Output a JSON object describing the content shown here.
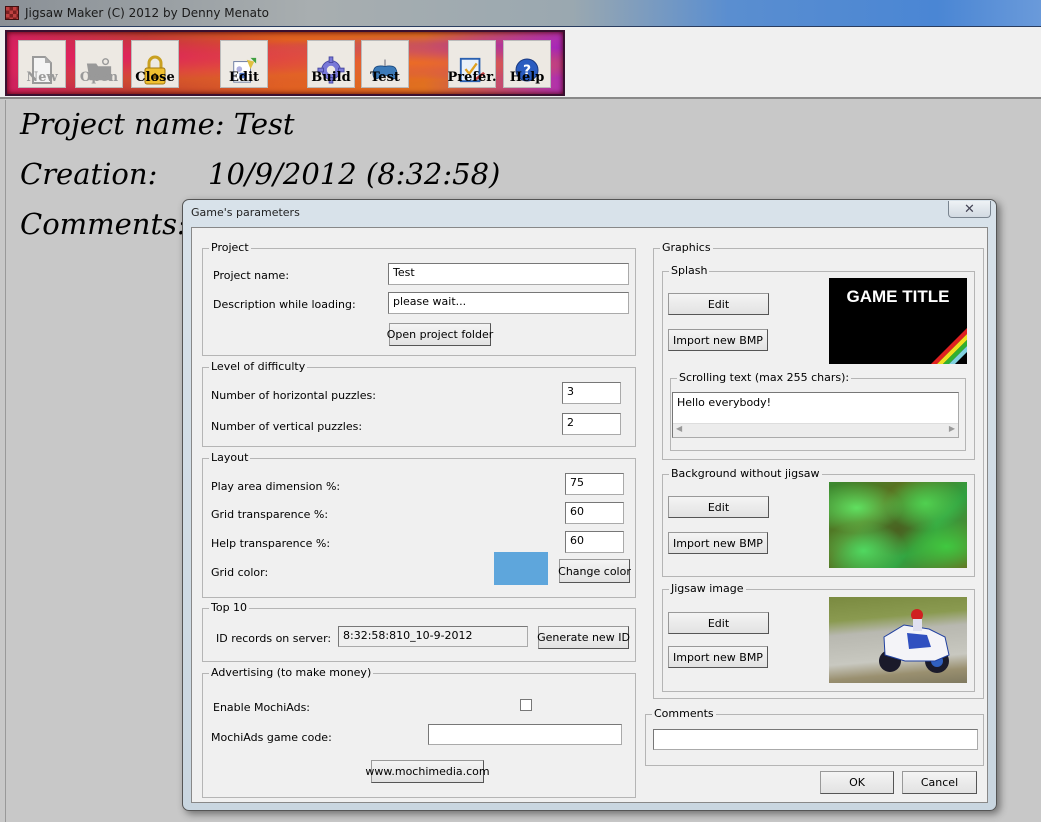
{
  "window": {
    "title": "Jigsaw Maker (C) 2012 by Denny Menato"
  },
  "toolbar": {
    "buttons": [
      {
        "label": "New",
        "icon": "new-file-icon",
        "enabled": false
      },
      {
        "label": "Open",
        "icon": "open-folder-icon",
        "enabled": false
      },
      {
        "label": "Close",
        "icon": "padlock-icon",
        "enabled": true
      },
      {
        "label": "Edit",
        "icon": "edit-document-icon",
        "enabled": true
      },
      {
        "label": "Build",
        "icon": "gear-icon",
        "enabled": true
      },
      {
        "label": "Test",
        "icon": "gamepad-icon",
        "enabled": true
      },
      {
        "label": "Prefer.",
        "icon": "preferences-checklist-icon",
        "enabled": true
      },
      {
        "label": "Help",
        "icon": "help-icon",
        "enabled": true
      }
    ]
  },
  "project_info": {
    "name_label": "Project name:",
    "name_value": "Test",
    "creation_label": "Creation:",
    "creation_value": "10/9/2012 (8:32:58)",
    "comments_label": "Comments:"
  },
  "dialog": {
    "title": "Game's parameters",
    "close_glyph": "✕",
    "project": {
      "legend": "Project",
      "name_label": "Project name:",
      "name_value": "Test",
      "desc_label": "Description while loading:",
      "desc_value": "please wait...",
      "open_folder_button": "Open project folder"
    },
    "difficulty": {
      "legend": "Level of difficulty",
      "horizontal_label": "Number of horizontal puzzles:",
      "horizontal_value": "3",
      "vertical_label": "Number of vertical puzzles:",
      "vertical_value": "2"
    },
    "layout": {
      "legend": "Layout",
      "play_area_label": "Play area dimension %:",
      "play_area_value": "75",
      "grid_transp_label": "Grid transparence %:",
      "grid_transp_value": "60",
      "help_transp_label": "Help transparence %:",
      "help_transp_value": "60",
      "grid_color_label": "Grid color:",
      "grid_color": "#5ea6dc",
      "change_color_button": "Change color"
    },
    "top10": {
      "legend": "Top 10",
      "id_label": "ID records on server:",
      "id_value": "8:32:58:810_10-9-2012",
      "generate_button": "Generate new ID"
    },
    "advertising": {
      "legend": "Advertising (to make money)",
      "enable_label": "Enable MochiAds:",
      "enable_checked": false,
      "code_label": "MochiAds game code:",
      "code_value": "",
      "site_button": "www.mochimedia.com"
    },
    "graphics": {
      "legend": "Graphics",
      "splash": {
        "legend": "Splash",
        "edit_button": "Edit",
        "import_button": "Import new BMP",
        "preview_text": "GAME TITLE",
        "scrolling_legend": "Scrolling text (max 255 chars):",
        "scrolling_value": "Hello everybody!"
      },
      "background": {
        "legend": "Background without jigsaw",
        "edit_button": "Edit",
        "import_button": "Import new BMP"
      },
      "jigsaw": {
        "legend": "Jigsaw image",
        "edit_button": "Edit",
        "import_button": "Import new BMP"
      }
    },
    "comments": {
      "legend": "Comments",
      "value": ""
    },
    "ok_button": "OK",
    "cancel_button": "Cancel"
  }
}
